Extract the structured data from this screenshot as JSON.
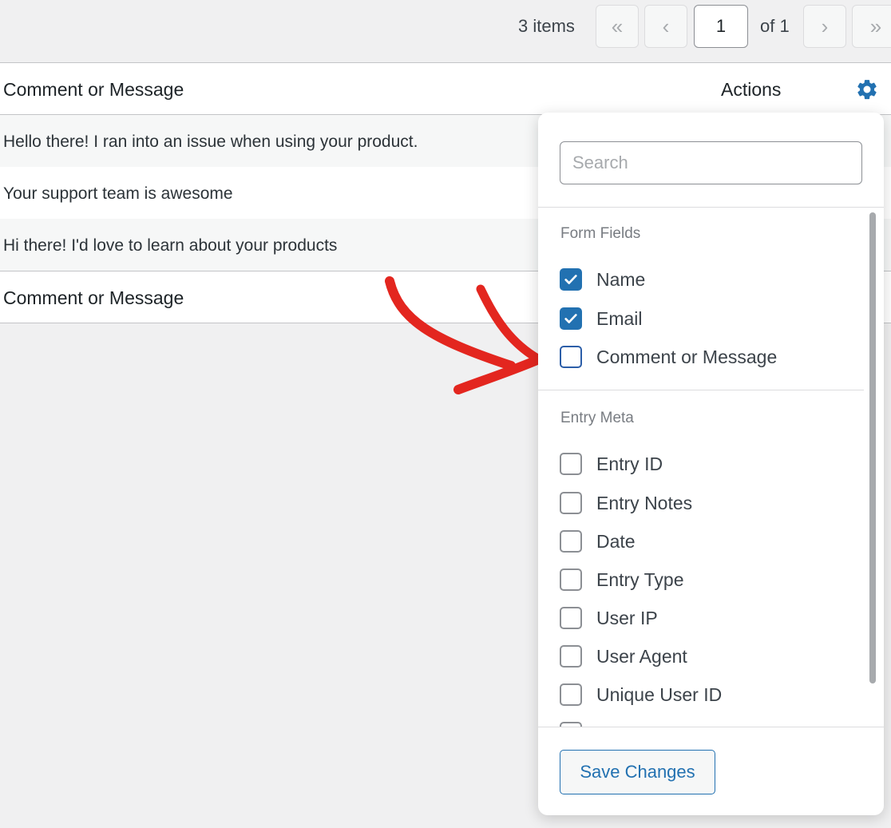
{
  "pagination": {
    "items_count": "3 items",
    "first": "«",
    "prev": "‹",
    "current_page": "1",
    "of_total": "of 1",
    "next": "›",
    "last": "»"
  },
  "table": {
    "header_column": "Comment or Message",
    "header_actions": "Actions",
    "settings_icon": "gear-icon",
    "rows": [
      "Hello there! I ran into an issue when using your product.",
      "Your support team is awesome",
      "Hi there! I'd love to learn about your products"
    ],
    "footer_column": "Comment or Message"
  },
  "panel": {
    "search_placeholder": "Search",
    "form_fields_title": "Form Fields",
    "form_fields": [
      {
        "label": "Name",
        "checked": true
      },
      {
        "label": "Email",
        "checked": true
      },
      {
        "label": "Comment or Message",
        "checked": false
      }
    ],
    "entry_meta_title": "Entry Meta",
    "entry_meta": [
      {
        "label": "Entry ID",
        "checked": false
      },
      {
        "label": "Entry Notes",
        "checked": false
      },
      {
        "label": "Date",
        "checked": false
      },
      {
        "label": "Entry Type",
        "checked": false
      },
      {
        "label": "User IP",
        "checked": false
      },
      {
        "label": "User Agent",
        "checked": false
      },
      {
        "label": "Unique User ID",
        "checked": false
      }
    ],
    "save_label": "Save Changes"
  },
  "colors": {
    "accent": "#2271b1",
    "arrow": "#e3261f"
  }
}
